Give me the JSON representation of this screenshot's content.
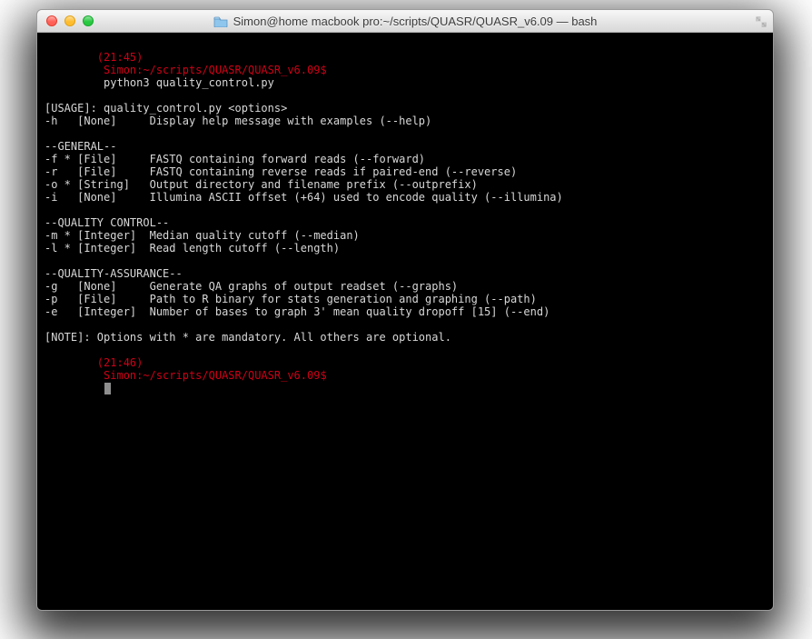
{
  "window": {
    "title": "Simon@home macbook pro:~/scripts/QUASR/QUASR_v6.09 — bash"
  },
  "prompt1": {
    "time": "(21:45)",
    "path": "Simon:~/scripts/QUASR/QUASR_v6.09$",
    "command": "python3 quality_control.py"
  },
  "usage_line": "[USAGE]: quality_control.py <options>",
  "help_line": "-h   [None]     Display help message with examples (--help)",
  "sections": {
    "general": {
      "header": "--GENERAL--",
      "rows": [
        "-f * [File]     FASTQ containing forward reads (--forward)",
        "-r   [File]     FASTQ containing reverse reads if paired-end (--reverse)",
        "-o * [String]   Output directory and filename prefix (--outprefix)",
        "-i   [None]     Illumina ASCII offset (+64) used to encode quality (--illumina)"
      ]
    },
    "quality_control": {
      "header": "--QUALITY CONTROL--",
      "rows": [
        "-m * [Integer]  Median quality cutoff (--median)",
        "-l * [Integer]  Read length cutoff (--length)"
      ]
    },
    "quality_assurance": {
      "header": "--QUALITY-ASSURANCE--",
      "rows": [
        "-g   [None]     Generate QA graphs of output readset (--graphs)",
        "-p   [File]     Path to R binary for stats generation and graphing (--path)",
        "-e   [Integer]  Number of bases to graph 3' mean quality dropoff [15] (--end)"
      ]
    }
  },
  "note_line": "[NOTE]: Options with * are mandatory. All others are optional.",
  "prompt2": {
    "time": "(21:46)",
    "path": "Simon:~/scripts/QUASR/QUASR_v6.09$"
  }
}
